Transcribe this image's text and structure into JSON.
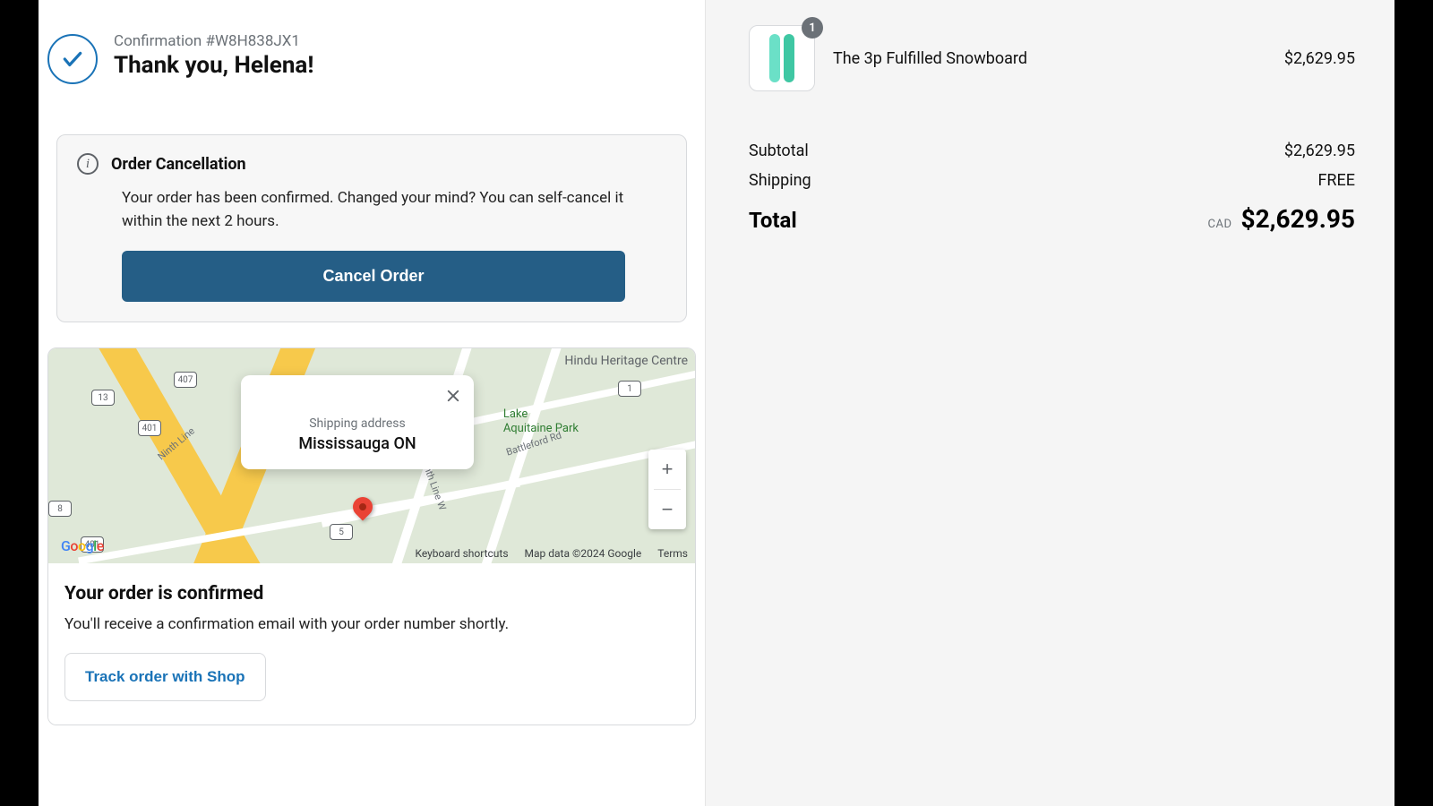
{
  "header": {
    "confirmation_label": "Confirmation #W8H838JX1",
    "thank_you": "Thank you, Helena!"
  },
  "cancellation": {
    "title": "Order Cancellation",
    "body": "Your order has been confirmed. Changed your mind? You can self-cancel it within the next 2 hours.",
    "button": "Cancel Order"
  },
  "map": {
    "popup_label": "Shipping address",
    "popup_city": "Mississauga ON",
    "poi_park_line1": "Lake",
    "poi_park_line2": "Aquitaine Park",
    "poi_hindu": "Hindu Heritage Centre",
    "road_ninth": "Ninth Line",
    "road_tenth": "Tenth Line W",
    "road_battleford": "Battleford Rd",
    "shield_407": "407",
    "shield_401a": "401",
    "shield_401b": "401",
    "shield_13": "13",
    "shield_1": "1",
    "shield_5": "5",
    "shield_8": "8",
    "shortcuts": "Keyboard shortcuts",
    "mapdata": "Map data ©2024 Google",
    "terms": "Terms"
  },
  "confirmed": {
    "title": "Your order is confirmed",
    "text": "You'll receive a confirmation email with your order number shortly.",
    "track_button": "Track order with Shop"
  },
  "summary": {
    "item_name": "The 3p Fulfilled Snowboard",
    "item_qty": "1",
    "item_price": "$2,629.95",
    "subtotal_label": "Subtotal",
    "subtotal_value": "$2,629.95",
    "shipping_label": "Shipping",
    "shipping_value": "FREE",
    "total_label": "Total",
    "total_currency": "CAD",
    "total_value": "$2,629.95"
  }
}
